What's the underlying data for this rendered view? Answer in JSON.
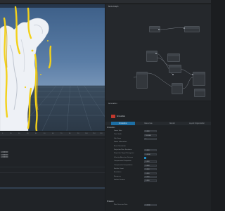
{
  "window": {
    "title": ""
  },
  "graph": {
    "title": "Node Graph"
  },
  "inspector": {
    "header": "Simulation",
    "tabs": [
      "Simulation",
      "Resources",
      "Render",
      "Layout Organization"
    ],
    "active_tab": 0,
    "sections": [
      {
        "label": "Simulation",
        "rows": [
          {
            "label": "Frame Rate",
            "value": "0.000"
          },
          {
            "label": "Time Scale",
            "value": "24.0000"
          },
          {
            "label": "Sub Steps",
            "value": "1"
          },
          {
            "label": "Frame Information",
            "value": ""
          },
          {
            "label": "Reset Simulation",
            "value": ""
          },
          {
            "label": "Projection Max. Iterations",
            "value": "0.000"
          },
          {
            "label": "Projection Target Divergence",
            "value": "0.0000"
          },
          {
            "label": "Velocity Advection Scheme",
            "checkbox": true
          },
          {
            "label": "Compression Dissipation",
            "value": "0.000"
          },
          {
            "label": "Compression Interpolation",
            "value": "0.000"
          },
          {
            "label": "Particle Count",
            "value": "0.000"
          },
          {
            "label": "Resolution",
            "value": "0.000"
          },
          {
            "label": "Buoyancy",
            "value": "0.000"
          },
          {
            "label": "Surface Tension",
            "value": "0.000"
          }
        ]
      },
      {
        "label": "Emission",
        "rows": [
          {
            "label": "Max. Emission Rate",
            "value": "0.0000"
          }
        ]
      }
    ]
  },
  "timeline": {
    "ruler": [
      "0",
      "10",
      "20",
      "30",
      "40",
      "50",
      "60",
      "70",
      "80",
      "90",
      "100",
      "110",
      "120"
    ],
    "values": [
      "0.000000",
      "0.000000",
      "0.000000"
    ]
  },
  "colors": {
    "accent": "#1d6fa5",
    "highlight_yellow": "#f3d11a"
  }
}
